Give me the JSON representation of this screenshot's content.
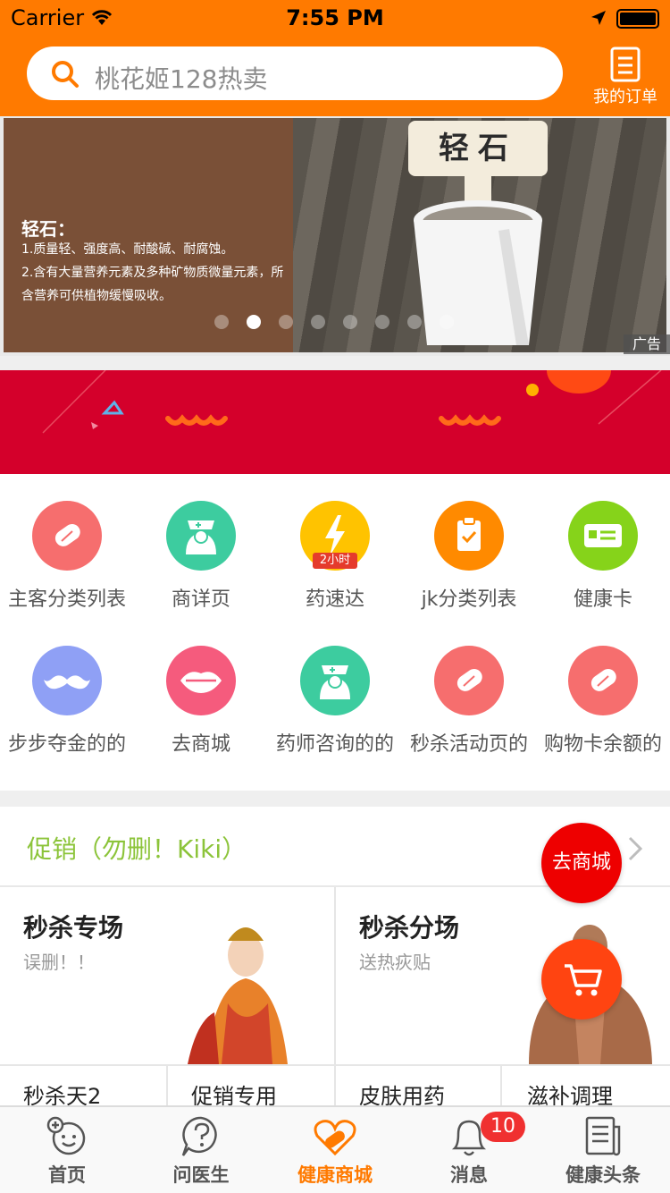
{
  "status_bar": {
    "carrier": "Carrier",
    "time": "7:55 PM"
  },
  "header": {
    "search_placeholder": "桃花姬128热卖",
    "orders_label": "我的订单",
    "color": "#ff7a00"
  },
  "banner": {
    "title": "轻石：",
    "lines": [
      "1.质量轻、强度高、耐酸碱、耐腐蚀。",
      "2.含有大量营养元素及多种矿物质微量元素，所含营养可供植物缓慢吸收。"
    ],
    "tag_text": "轻石",
    "ad_label": "广告",
    "page_count": 8,
    "active_index": 1
  },
  "grid": {
    "items": [
      {
        "label": "主客分类列表",
        "icon": "pill-icon",
        "color": "#f66e6e"
      },
      {
        "label": "商详页",
        "icon": "nurse-icon",
        "color": "#3dcc9f"
      },
      {
        "label": "药速达",
        "icon": "lightning-icon",
        "color": "#ffc300",
        "badge": "2小时"
      },
      {
        "label": "jk分类列表",
        "icon": "clipboard-icon",
        "color": "#ff8a00"
      },
      {
        "label": "健康卡",
        "icon": "card-icon",
        "color": "#86d31a"
      },
      {
        "label": "步步夺金的的",
        "icon": "mustache-icon",
        "color": "#8fa0f5"
      },
      {
        "label": "去商城",
        "icon": "lips-icon",
        "color": "#f55b7d"
      },
      {
        "label": "药师咨询的的",
        "icon": "nurse-icon",
        "color": "#3dcc9f"
      },
      {
        "label": "秒杀活动页的",
        "icon": "pill-icon",
        "color": "#f66e6e"
      },
      {
        "label": "购物卡余额的",
        "icon": "pill-icon",
        "color": "#f66e6e"
      }
    ]
  },
  "promotion": {
    "title": "促销（勿删！Kiki）",
    "go_mall": "去商城",
    "cards": [
      {
        "title": "秒杀专场",
        "subtitle": "误删！！"
      },
      {
        "title": "秒杀分场",
        "subtitle": "送热疢贴"
      }
    ],
    "sub_items": [
      "秒杀天2",
      "促销专用",
      "皮肤用药",
      "滋补调理"
    ]
  },
  "tabbar": {
    "tabs": [
      {
        "label": "首页",
        "icon": "home-face-icon"
      },
      {
        "label": "问医生",
        "icon": "question-icon"
      },
      {
        "label": "健康商城",
        "icon": "heart-pill-icon"
      },
      {
        "label": "消息",
        "icon": "bell-icon"
      },
      {
        "label": "健康头条",
        "icon": "news-icon"
      }
    ],
    "active_index": 2,
    "message_badge": "10"
  }
}
